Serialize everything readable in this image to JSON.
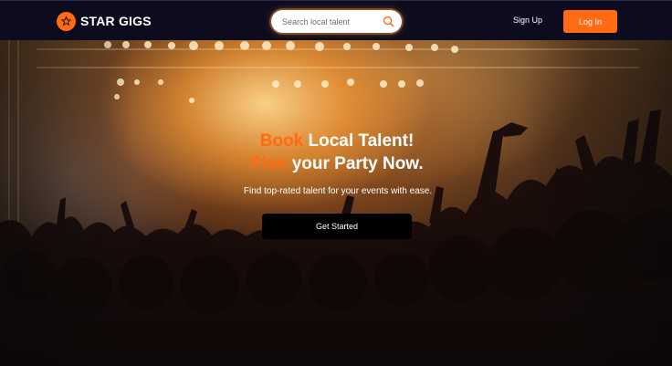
{
  "brand": {
    "name": "STAR GIGS",
    "accent_color": "#ff6a13",
    "nav_background": "#0d0c1f"
  },
  "nav": {
    "search": {
      "placeholder": "Search local talent",
      "value": "",
      "icon": "search-icon"
    },
    "signup_label": "Sign Up",
    "login_label": "Log In"
  },
  "hero": {
    "headline_line1": {
      "accent": "Book",
      "rest": "Local Talent!"
    },
    "headline_line2": {
      "accent": "Plan",
      "rest": "your Party Now."
    },
    "subtext": "Find top-rated talent for your events with ease.",
    "cta_label": "Get Started",
    "background_image": "concert crowd with raised hands under warm stage lights"
  }
}
